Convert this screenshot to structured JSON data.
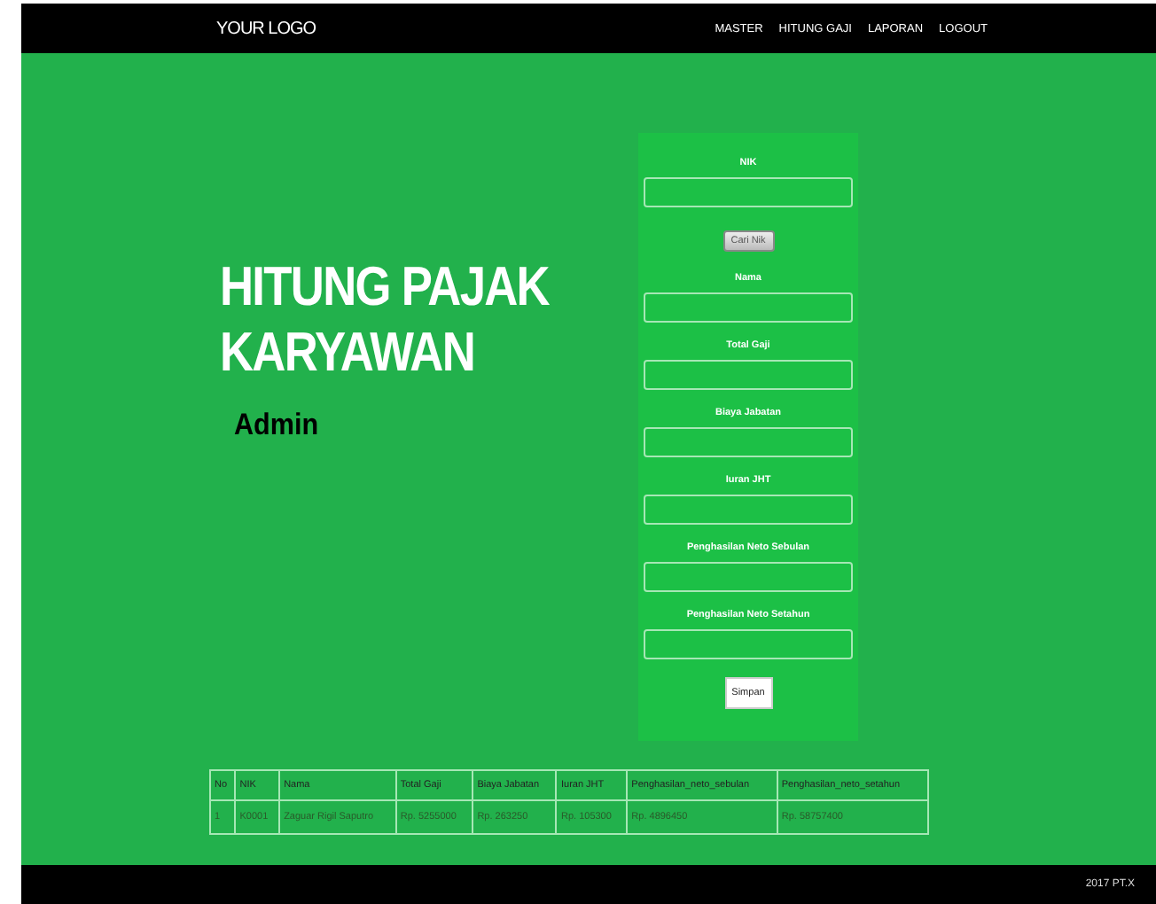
{
  "logo": "YOUR LOGO",
  "nav": [
    "MASTER",
    "HITUNG GAJI",
    "LAPORAN",
    "LOGOUT"
  ],
  "hero": {
    "title": "HITUNG PAJAK KARYAWAN",
    "subtitle": "Admin"
  },
  "form": {
    "fields": [
      {
        "label": "NIK"
      },
      {
        "label": "Nama"
      },
      {
        "label": "Total Gaji"
      },
      {
        "label": "Biaya Jabatan"
      },
      {
        "label": "Iuran JHT"
      },
      {
        "label": "Penghasilan Neto Sebulan"
      },
      {
        "label": "Penghasilan Neto Setahun"
      }
    ],
    "search_button": "Cari Nik",
    "submit_button": "Simpan"
  },
  "table": {
    "columns": [
      "No",
      "NIK",
      "Nama",
      "Total Gaji",
      "Biaya Jabatan",
      "Iuran JHT",
      "Penghasilan_neto_sebulan",
      "Penghasilan_neto_setahun"
    ],
    "rows": [
      [
        "1",
        "K0001",
        "Zaguar Rigil Saputro",
        "Rp. 5255000",
        "Rp. 263250",
        "Rp. 105300",
        "Rp. 4896450",
        "Rp. 58757400"
      ]
    ]
  },
  "footer": "2017 PT.X"
}
